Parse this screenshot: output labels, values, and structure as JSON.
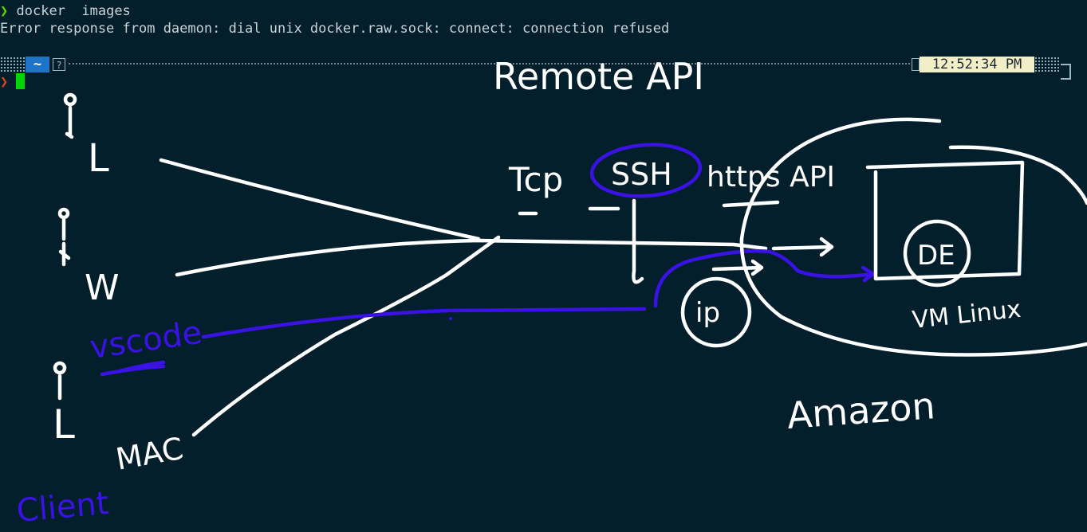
{
  "terminal": {
    "prompt_symbol": "❯",
    "command": "docker  images",
    "error_output": "Error response from daemon: dial unix docker.raw.sock: connect: connection refused",
    "prompt_bar": {
      "dir": "~",
      "help_glyph": "?",
      "time": "12:52:34 PM"
    },
    "second_prompt_symbol": "❯"
  },
  "annotations": {
    "title": "Remote API",
    "protocols": [
      "Tcp",
      "SSH",
      "https API"
    ],
    "clients": [
      "L",
      "W",
      "MAC"
    ],
    "client_label": "Client",
    "editor_label": "vscode",
    "ip_label": "ip",
    "de_label": "DE",
    "vm_label": "VM Linux",
    "cloud_label": "Amazon",
    "colors": {
      "ink_white": "#ffffff",
      "ink_blue": "#3b12e6",
      "background": "#021f2b",
      "cursor": "#00d700"
    }
  }
}
